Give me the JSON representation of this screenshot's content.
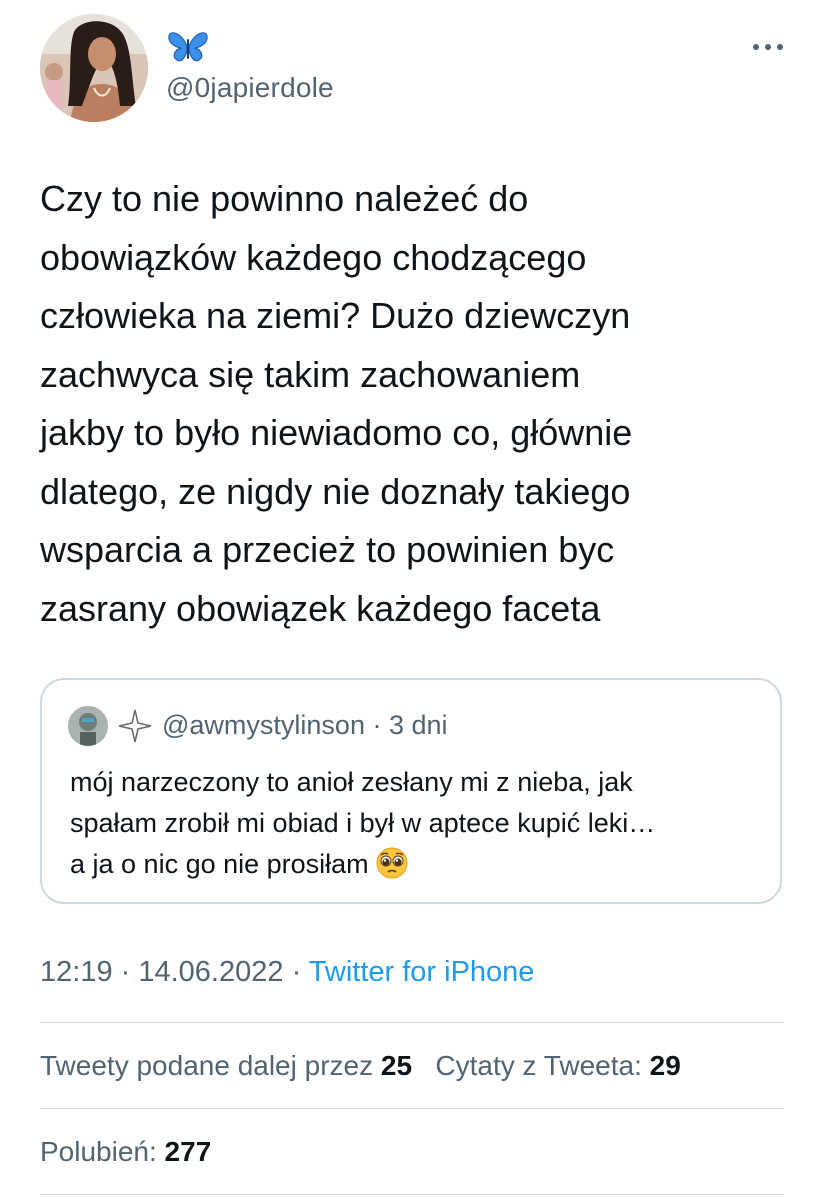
{
  "author": {
    "display_name_icon": "butterfly-icon",
    "handle": "@0japierdole"
  },
  "tweet": {
    "text": "Czy to nie powinno należeć do\nobowiązków każdego chodzącego\nczłowieka na ziemi? Dużo dziewczyn\nzachwyca się takim zachowaniem\njakby to było niewiadomo co, głównie\ndlatego, ze nigdy nie doznały takiego\nwsparcia a przecież to powinien byc\nzasrany obowiązek każdego faceta"
  },
  "quoted_tweet": {
    "name_icon": "sparkle-icon",
    "handle": "@awmystylinson",
    "separator": " · ",
    "time": "3 dni",
    "lines": [
      "mój narzeczony to anioł zesłany mi z nieba, jak",
      "spałam zrobił mi obiad i był w aptece kupić leki…",
      "a ja o nic go nie prosiłam"
    ],
    "emoji": "pleading-face-emoji"
  },
  "meta": {
    "time": "12:19",
    "separator1": " · ",
    "date": "14.06.2022",
    "separator2": " · ",
    "source": "Twitter for iPhone"
  },
  "stats": {
    "retweets_label": "Tweety podane dalej przez ",
    "retweets_count": "25",
    "quotes_label": "Cytaty z Tweeta: ",
    "quotes_count": "29",
    "likes_label": "Polubień: ",
    "likes_count": "277"
  },
  "colors": {
    "text": "#0f1419",
    "secondary": "#536471",
    "link": "#1d9bf0",
    "border": "#cfd9de",
    "butterfly": "#3a8fe8"
  }
}
